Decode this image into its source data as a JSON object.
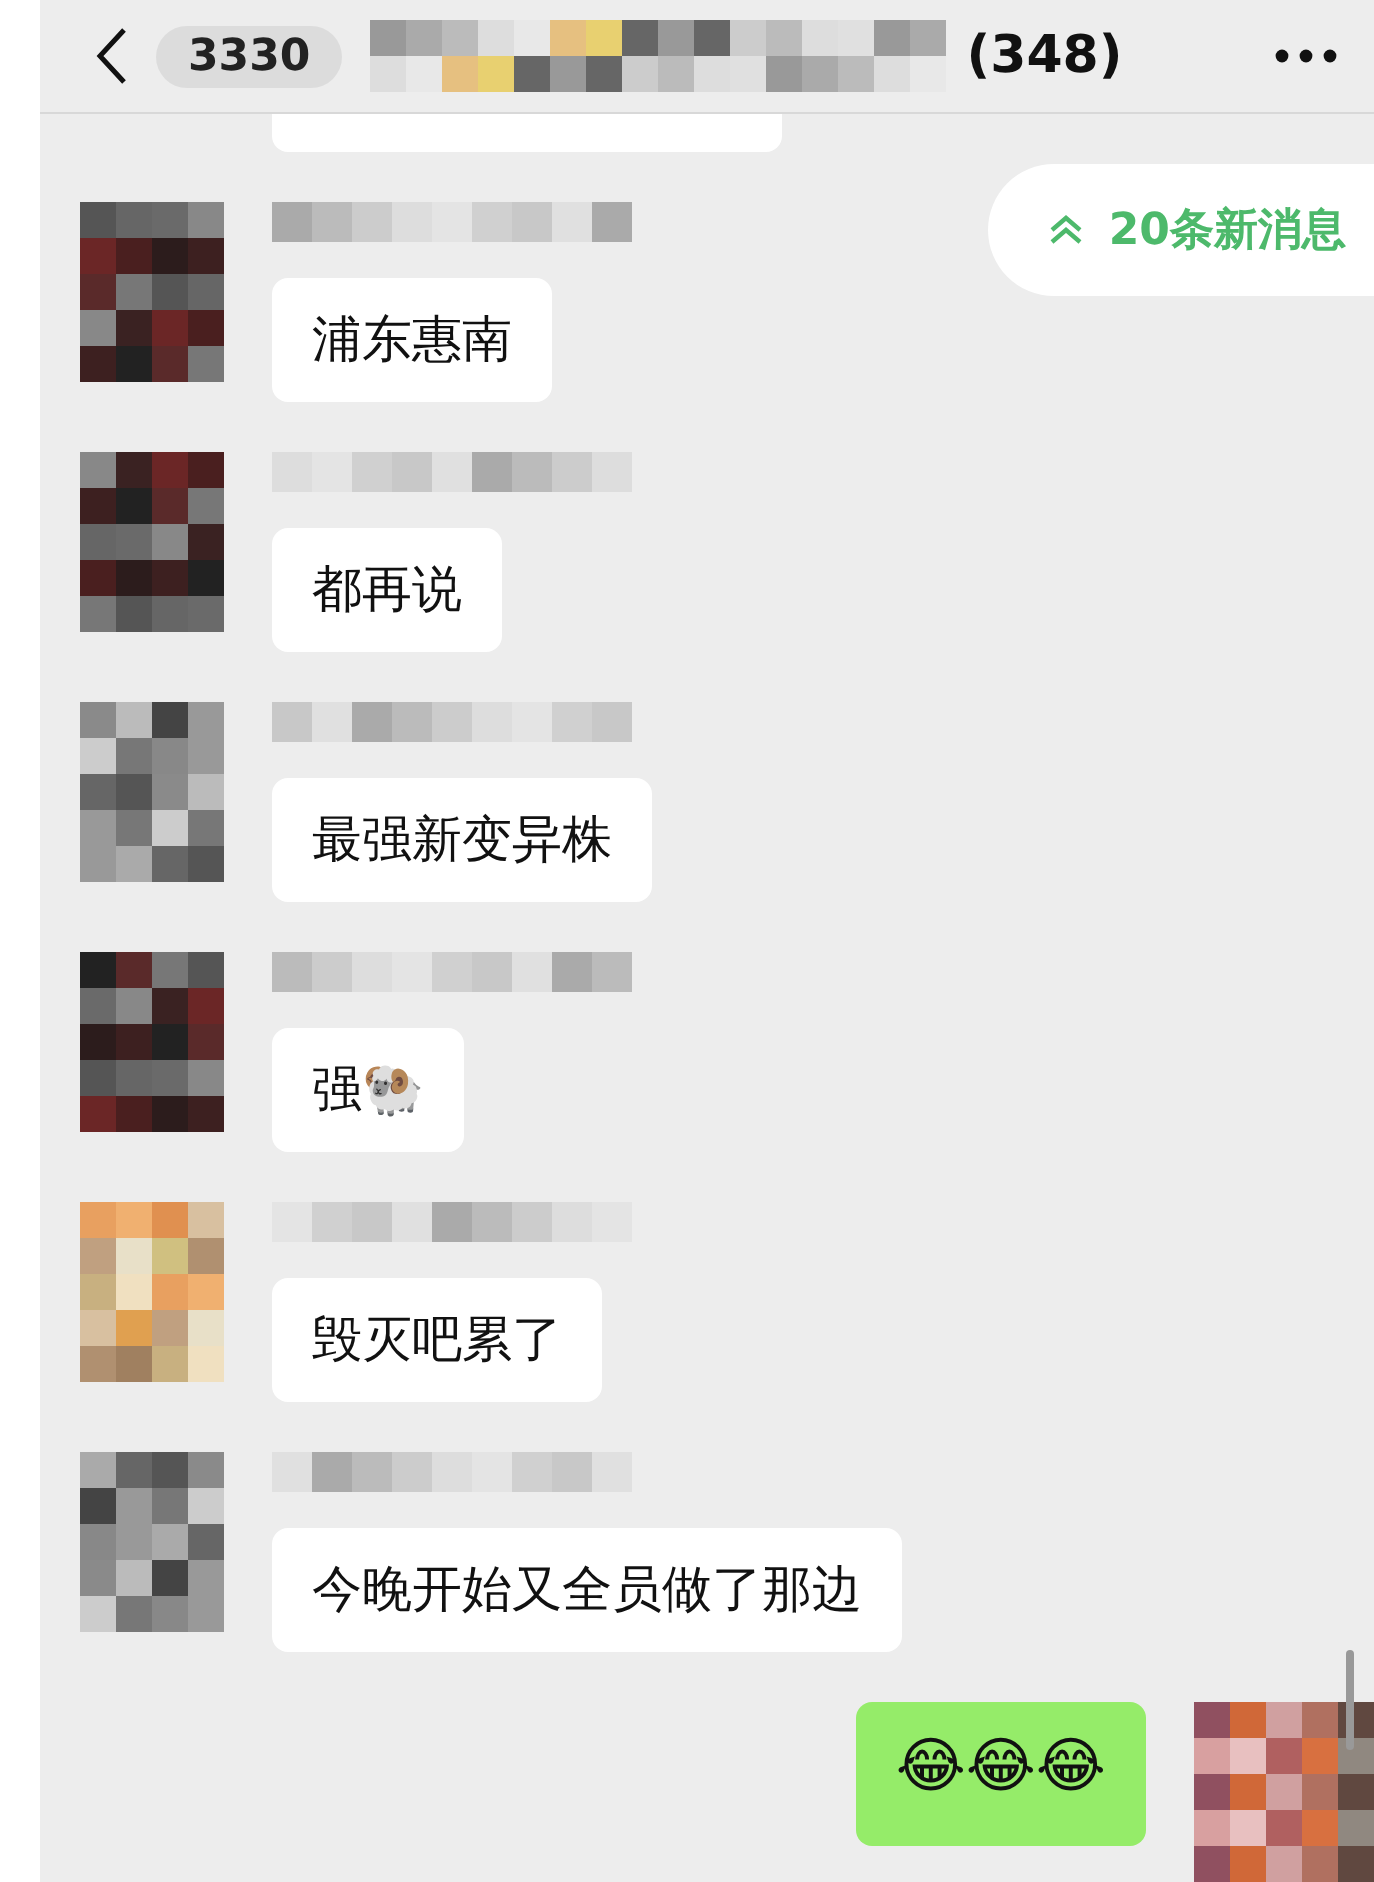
{
  "header": {
    "unread_count": "3330",
    "title_suffix": "(348)"
  },
  "new_messages": "20条新消息",
  "messages": [
    {
      "kind": "incoming",
      "text": "浦东惠南"
    },
    {
      "kind": "incoming",
      "text": "都再说"
    },
    {
      "kind": "incoming",
      "text": "最强新变异株"
    },
    {
      "kind": "incoming",
      "text": "强🐏"
    },
    {
      "kind": "incoming",
      "text": "毁灭吧累了"
    },
    {
      "kind": "incoming",
      "text": "今晚开始又全员做了那边"
    },
    {
      "kind": "outgoing",
      "text": "😂😂😂"
    }
  ]
}
